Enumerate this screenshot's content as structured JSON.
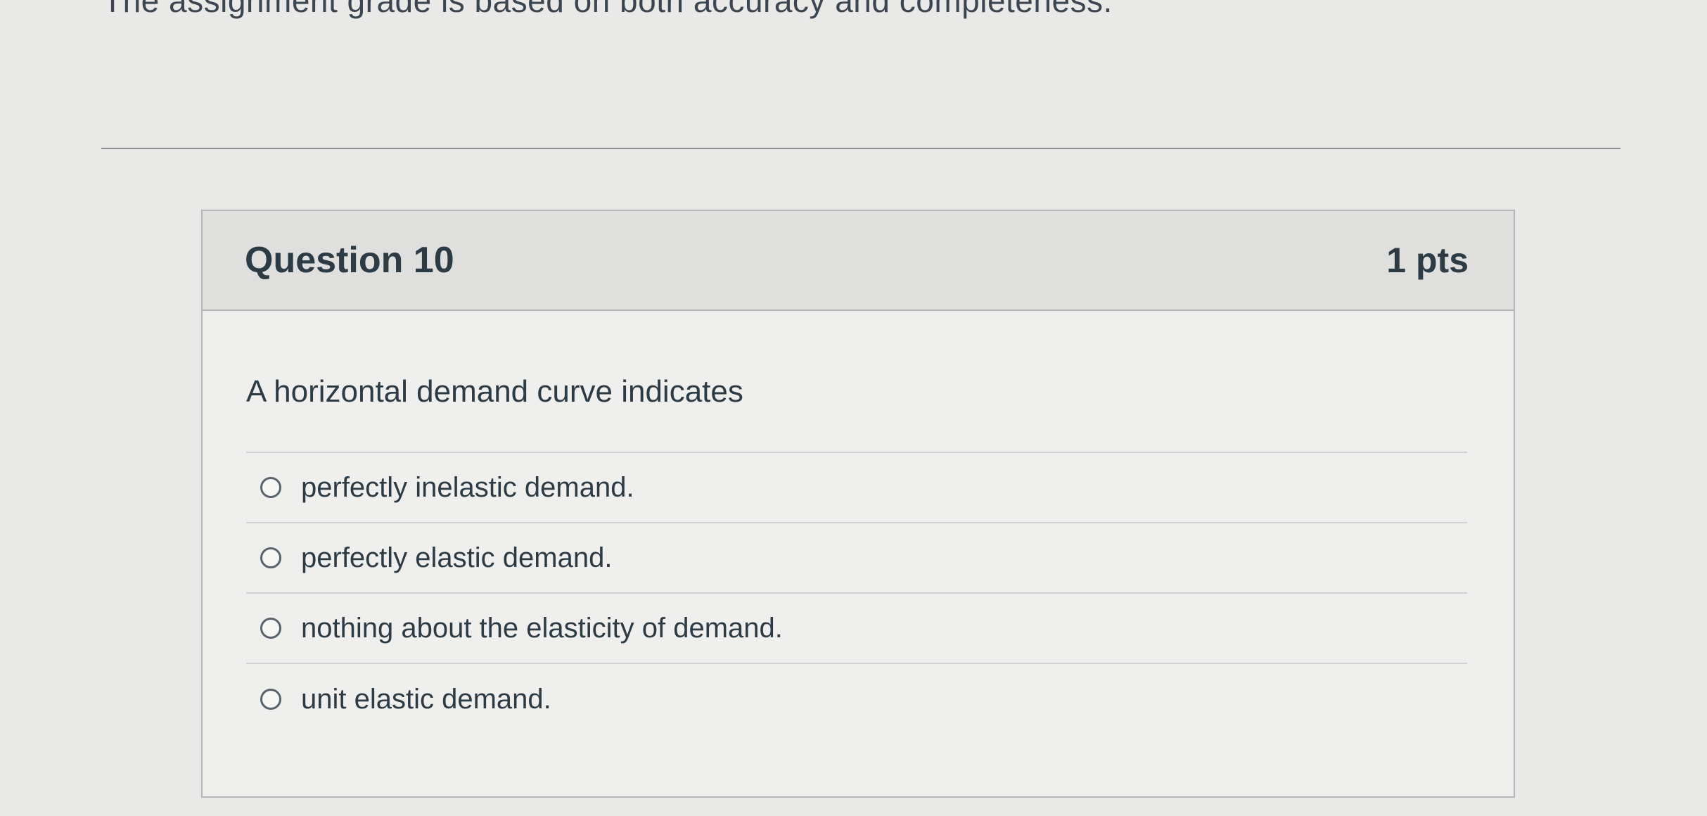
{
  "page": {
    "instructions": "The assignment grade is based on both accuracy and completeness."
  },
  "question": {
    "title": "Question 10",
    "points": "1 pts",
    "text": "A horizontal demand curve indicates",
    "answers": [
      {
        "label": "perfectly inelastic demand.",
        "selected": false
      },
      {
        "label": "perfectly elastic demand.",
        "selected": false
      },
      {
        "label": "nothing about the elasticity of demand.",
        "selected": false
      },
      {
        "label": "unit elastic demand.",
        "selected": false
      }
    ]
  },
  "colors": {
    "background": "#e9e9e7",
    "header": "#dfdfdd",
    "text": "#2d3b45"
  }
}
